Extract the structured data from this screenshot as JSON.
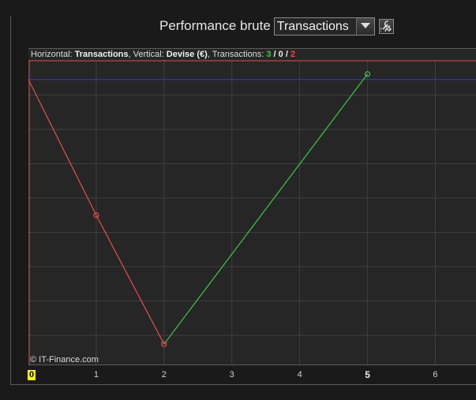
{
  "toolbar": {
    "label": "Performance brute",
    "dropdown_value": "Transactions",
    "tool_icon": "wrench-icon"
  },
  "chart_info": {
    "prefix_horizontal": "Horizontal: ",
    "horizontal_value": "Transactions",
    "prefix_vertical": ", Vertical: ",
    "vertical_value": "Devise (€)",
    "prefix_transactions": ", Transactions: ",
    "wins": "3",
    "separator1": " / ",
    "neutral": "0",
    "separator2": " / ",
    "losses": "2"
  },
  "watermark": "© IT-Finance.com",
  "chart_data": {
    "type": "line",
    "xlabel": "Transactions",
    "ylabel": "Devise (€)",
    "x_ticks": [
      "0",
      "1",
      "2",
      "3",
      "4",
      "5",
      "6"
    ],
    "xlim": [
      0,
      6.6
    ],
    "ylim": [
      -4.2,
      0.45
    ],
    "points": [
      {
        "x": 0,
        "y": 0
      },
      {
        "x": 1,
        "y": -2
      },
      {
        "x": 2,
        "y": -3.9
      },
      {
        "x": 5,
        "y": 0.08
      }
    ],
    "segment_colors": [
      "#e84c4c",
      "#e84c4c",
      "#3fc93f"
    ],
    "reference_line_y": 0,
    "reference_line_color": "#3333ff",
    "grid": true
  },
  "colors": {
    "loss": "#e84c4c",
    "win": "#3fc93f",
    "reference": "#3333ff"
  }
}
